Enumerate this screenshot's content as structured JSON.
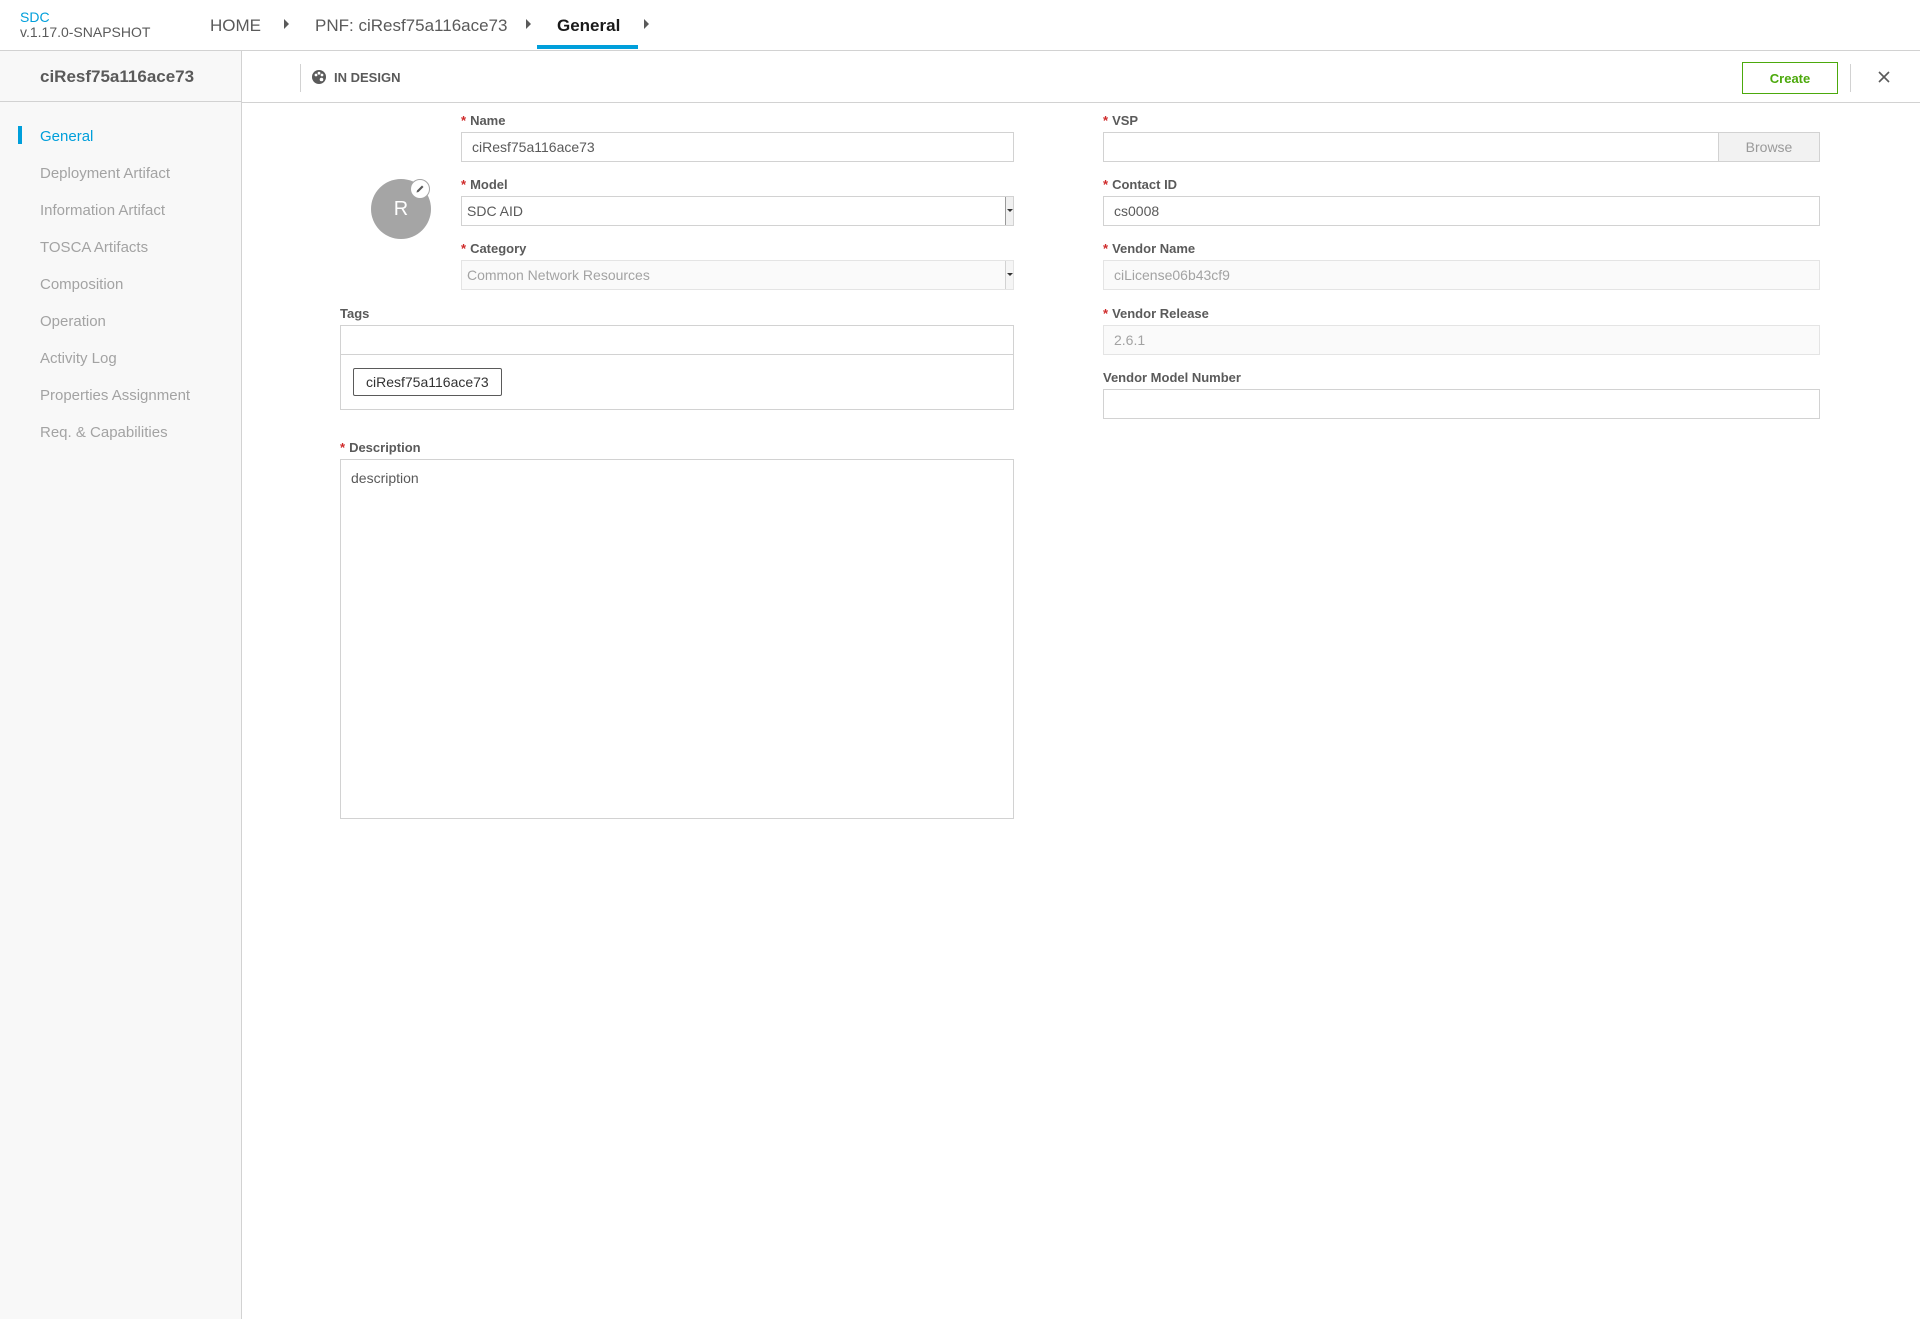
{
  "brand": {
    "name": "SDC",
    "version": "v.1.17.0-SNAPSHOT"
  },
  "breadcrumb": [
    {
      "label": "HOME"
    },
    {
      "label": "PNF: ciResf75a116ace73"
    },
    {
      "label": "General"
    }
  ],
  "sidebar": {
    "title": "ciResf75a116ace73",
    "items": [
      {
        "label": "General"
      },
      {
        "label": "Deployment Artifact"
      },
      {
        "label": "Information Artifact"
      },
      {
        "label": "TOSCA Artifacts"
      },
      {
        "label": "Composition"
      },
      {
        "label": "Operation"
      },
      {
        "label": "Activity Log"
      },
      {
        "label": "Properties Assignment"
      },
      {
        "label": "Req. & Capabilities"
      }
    ]
  },
  "subheader": {
    "status": "IN DESIGN",
    "create_label": "Create"
  },
  "form": {
    "avatar_letter": "R",
    "name": {
      "label": "Name",
      "value": "ciResf75a116ace73"
    },
    "model": {
      "label": "Model",
      "value": "SDC AID"
    },
    "category": {
      "label": "Category",
      "value": "Common Network Resources"
    },
    "tags": {
      "label": "Tags",
      "chips": [
        "ciResf75a116ace73"
      ]
    },
    "description": {
      "label": "Description",
      "value": "description"
    },
    "vsp": {
      "label": "VSP",
      "value": "",
      "browse_label": "Browse"
    },
    "contact_id": {
      "label": "Contact ID",
      "value": "cs0008"
    },
    "vendor_name": {
      "label": "Vendor Name",
      "value": "ciLicense06b43cf9"
    },
    "vendor_release": {
      "label": "Vendor Release",
      "value": "2.6.1"
    },
    "vendor_model_number": {
      "label": "Vendor Model Number",
      "value": ""
    }
  },
  "colors": {
    "accent": "#009fdb",
    "create": "#4ca90c",
    "required": "#cf2a2a"
  }
}
